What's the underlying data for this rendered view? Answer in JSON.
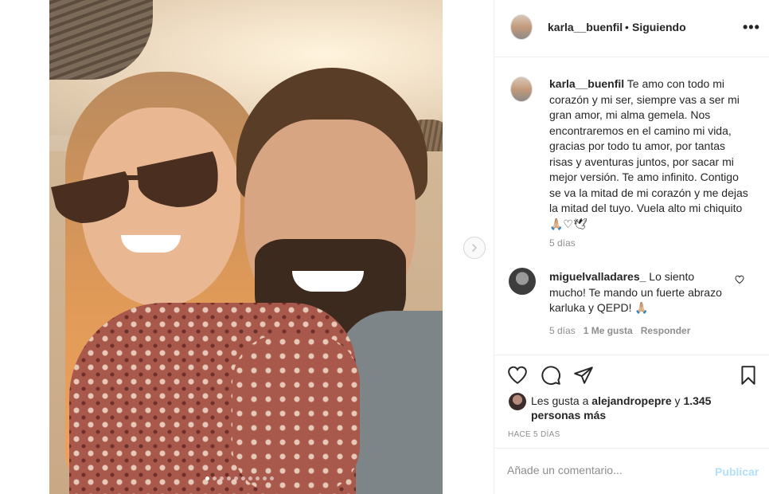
{
  "header": {
    "username": "karla__buenfil",
    "separator": "•",
    "follow_status": "Siguiendo",
    "more_icon": "more-horizontal-icon"
  },
  "caption": {
    "username": "karla__buenfil",
    "text": "Te amo con todo mi corazón y mi ser, siempre vas a ser mi gran amor, mi alma gemela. Nos encontraremos en el camino mi vida, gracias por todo tu amor, por tantas risas y aventuras juntos, por sacar mi mejor versión. Te amo infinito. Contigo se va la mitad de mi corazón y me dejas la mitad del tuyo. Vuela alto mi chiquito🙏🏼♡🕊",
    "time": "5 días"
  },
  "comment": {
    "username": "miguelvalladares_",
    "text": "Lo siento mucho! Te mando un fuerte abrazo karluka y QEPD! 🙏🏼",
    "time": "5 días",
    "likes": "1 Me gusta",
    "reply": "Responder"
  },
  "actions": {
    "like_icon": "heart-icon",
    "comment_icon": "comment-icon",
    "share_icon": "share-icon",
    "save_icon": "bookmark-icon"
  },
  "likes": {
    "prefix": "Les gusta a",
    "user": "alejandropepre",
    "connector": "y",
    "count": "1.345 personas más"
  },
  "posted": "HACE 5 DÍAS",
  "add_comment": {
    "placeholder": "Añade un comentario...",
    "publish": "Publicar"
  },
  "carousel": {
    "total_slides": 10,
    "active_index": 0
  },
  "colors": {
    "link_disabled": "#b2dffc",
    "muted": "#8e8e8e",
    "text": "#262626"
  }
}
